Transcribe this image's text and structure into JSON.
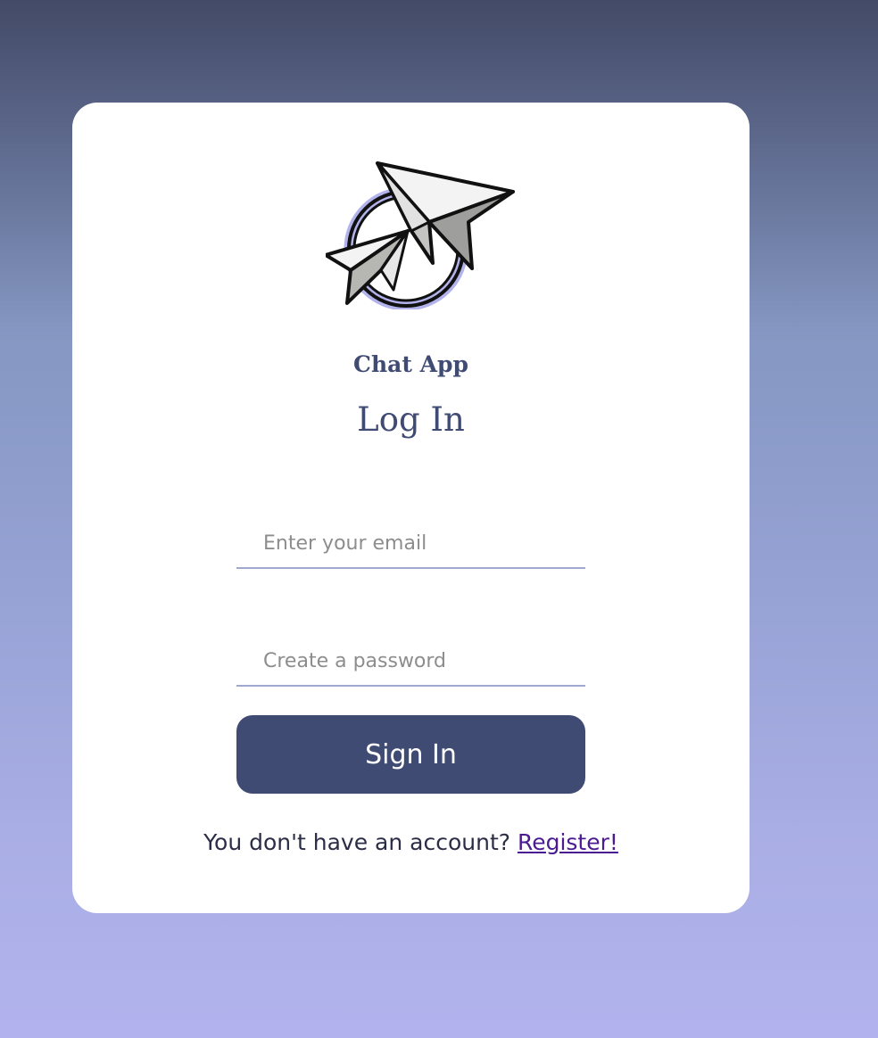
{
  "header": {
    "app_name": "Chat App",
    "title": "Log In"
  },
  "form": {
    "email_placeholder": "Enter your email",
    "email_value": "",
    "password_placeholder": "Create a password",
    "password_value": "",
    "submit_label": "Sign In"
  },
  "footer": {
    "prompt": "You don't have an account?",
    "register_link": "Register!"
  },
  "icons": {
    "logo": "paper-planes-logo-icon"
  },
  "colors": {
    "primary": "#3f4b73",
    "link": "#4b1b92",
    "logo_ring_accent": "#a9aae9"
  }
}
